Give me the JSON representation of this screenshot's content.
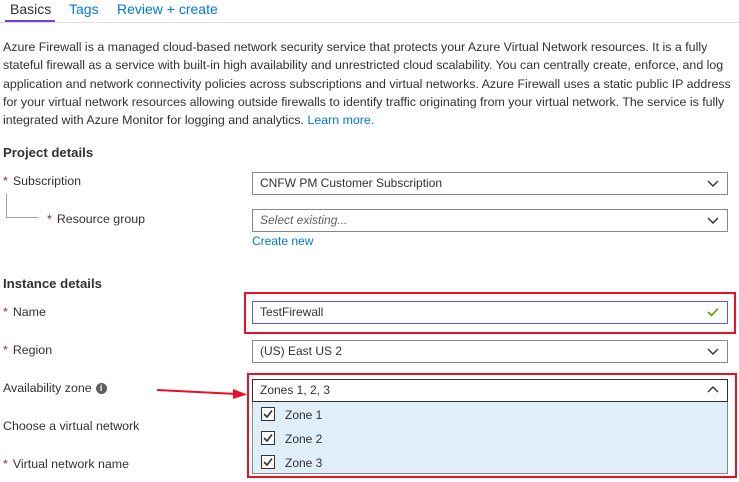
{
  "tabs": [
    {
      "label": "Basics",
      "active": true
    },
    {
      "label": "Tags",
      "active": false
    },
    {
      "label": "Review + create",
      "active": false
    }
  ],
  "description": {
    "text": "Azure Firewall is a managed cloud-based network security service that protects your Azure Virtual Network resources. It is a fully stateful firewall as a service with built-in high availability and unrestricted cloud scalability. You can centrally create, enforce, and log application and network connectivity policies across subscriptions and virtual networks. Azure Firewall uses a static public IP address for your virtual network resources allowing outside firewalls to identify traffic originating from your virtual network. The service is fully integrated with Azure Monitor for logging and analytics.",
    "learn_more": "Learn more."
  },
  "project_details": {
    "title": "Project details",
    "subscription_label": "Subscription",
    "subscription_value": "CNFW PM Customer Subscription",
    "resource_group_label": "Resource group",
    "resource_group_placeholder": "Select existing...",
    "create_new": "Create new"
  },
  "instance_details": {
    "title": "Instance details",
    "name_label": "Name",
    "name_value": "TestFirewall",
    "region_label": "Region",
    "region_value": "(US) East US 2",
    "availability_zone_label": "Availability zone",
    "availability_zone_value": "Zones 1, 2, 3",
    "vnet_label": "Choose a virtual network",
    "vnet_name_label": "Virtual network name",
    "zones": [
      {
        "label": "Zone 1",
        "checked": true
      },
      {
        "label": "Zone 2",
        "checked": true
      },
      {
        "label": "Zone 3",
        "checked": true
      }
    ]
  },
  "required_marker": "*",
  "info_icon_glyph": "i",
  "colors": {
    "accent": "#0078d4",
    "tab_underline": "#773adc",
    "highlight": "#e81123",
    "required": "#a4262c",
    "valid": "#57a300",
    "dropdown_bg": "#dfeef9"
  },
  "icons": [
    "chevron-down-icon",
    "chevron-up-icon",
    "checkmark-icon",
    "info-icon",
    "arrow-icon"
  ]
}
